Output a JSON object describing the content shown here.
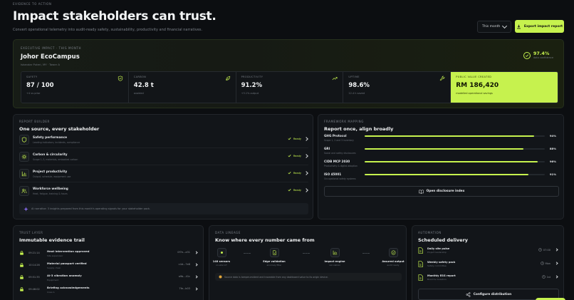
{
  "header": {
    "eyebrow": "EVIDENCE TO ACTION",
    "title": "Impact stakeholders can trust.",
    "subtitle": "Convert operational telemetry into audit-ready safety, sustainability, productivity and financial narratives.",
    "period_label": "This month",
    "export_label": "Export impact report"
  },
  "executive": {
    "eyebrow": "EXECUTIVE IMPACT · THIS MONTH",
    "site": "Johor EcoCampus",
    "site_sub": "Iskandar Puteri, MY · Tower A",
    "score": "97.4%",
    "score_label": "data confidence",
    "kpis": [
      {
        "label": "SAFETY",
        "value": "87 / 100",
        "sub": "+4 vs prior",
        "icon": "shield-check-icon"
      },
      {
        "label": "CARBON",
        "value": "42.8 t",
        "sub": "avoided",
        "icon": "leaf-icon"
      },
      {
        "label": "PRODUCTIVITY",
        "value": "91.2%",
        "sub": "+3.1% output",
        "icon": "trend-up-icon"
      },
      {
        "label": "UPTIME",
        "value": "98.6%",
        "sub": "12.4 h saved",
        "icon": "wrench-icon"
      },
      {
        "label": "PUBLIC VALUE CREATED",
        "value": "RM 186,420",
        "sub": "modelled operational savings",
        "icon": ""
      }
    ]
  },
  "builder": {
    "eyebrow": "REPORT BUILDER",
    "title": "One source, every stakeholder",
    "status_label": "Ready",
    "items": [
      {
        "name": "Safety performance",
        "desc": "Leading indicators, incidents, compliance",
        "icon": "shield-icon"
      },
      {
        "name": "Carbon & circularity",
        "desc": "Scope 1–3, materials, embodied carbon",
        "icon": "sun-icon"
      },
      {
        "name": "Project productivity",
        "desc": "Output, schedule, equipment use",
        "icon": "bar-chart-icon"
      },
      {
        "name": "Workforce wellbeing",
        "desc": "Heat, fatigue, training & hours",
        "icon": "people-icon"
      }
    ],
    "ai_note": "AI narrative: 3 insights prepared from this month's operating signals for your stakeholder pack."
  },
  "frameworks": {
    "eyebrow": "FRAMEWORK MAPPING",
    "title": "Report once, align broadly",
    "items": [
      {
        "name": "GHG Protocol",
        "sub": "Scope 1, 2 and 3 inventory",
        "value": 94,
        "label": "94%"
      },
      {
        "name": "GRI",
        "sub": "Social and safety disclosures",
        "value": 88,
        "label": "88%"
      },
      {
        "name": "CIDB MCP 2030",
        "sub": "Productivity & digital adoption",
        "value": 96,
        "label": "96%"
      },
      {
        "name": "ISO 45001",
        "sub": "Occupational safety systems",
        "value": 91,
        "label": "91%"
      }
    ],
    "button_label": "Open disclosure index"
  },
  "trail": {
    "eyebrow": "TRUST LAYER",
    "title": "Immutable evidence trail",
    "items": [
      {
        "time": "09:21:14",
        "name": "Heat intervention approved",
        "sub": "Site supervisor",
        "hash": "0f7e...a31"
      },
      {
        "time": "10:14:26",
        "name": "Material passport verified",
        "sub": "Supply chain",
        "hash": "c4d...7e8"
      },
      {
        "time": "09:51:35",
        "name": "AI-3 vibration anomaly",
        "sub": "Equipment",
        "hash": "a9b...41c"
      },
      {
        "time": "09:46:02",
        "name": "Briefing acknowledgements",
        "sub": "Crew A",
        "hash": "7fe...b03"
      }
    ]
  },
  "lineage": {
    "eyebrow": "DATA LINEAGE",
    "title": "Know where every number came from",
    "steps": [
      {
        "name": "148 sensors",
        "sub": "on-site IoT"
      },
      {
        "name": "Edge validation",
        "sub": "anomaly filter"
      },
      {
        "name": "Impact engine",
        "sub": "calculation"
      },
      {
        "name": "Assured output",
        "sub": "audit ready"
      }
    ],
    "note": "Source data is tamper-evident and traceable from any dashboard value to its origin device."
  },
  "sched": {
    "eyebrow": "AUTOMATION",
    "title": "Scheduled delivery",
    "items": [
      {
        "name": "Daily site pulse",
        "sub": "Project leadership",
        "time": "07:00"
      },
      {
        "name": "Weekly safety pack",
        "sub": "Safety committee",
        "time": "Mon"
      },
      {
        "name": "Monthly ESG report",
        "sub": "Board & investors",
        "time": "1st"
      }
    ],
    "button_label": "Configure distribution"
  },
  "colors": {
    "accent": "#c6f24e",
    "bg": "#0c0e11",
    "panel": "#121519"
  }
}
